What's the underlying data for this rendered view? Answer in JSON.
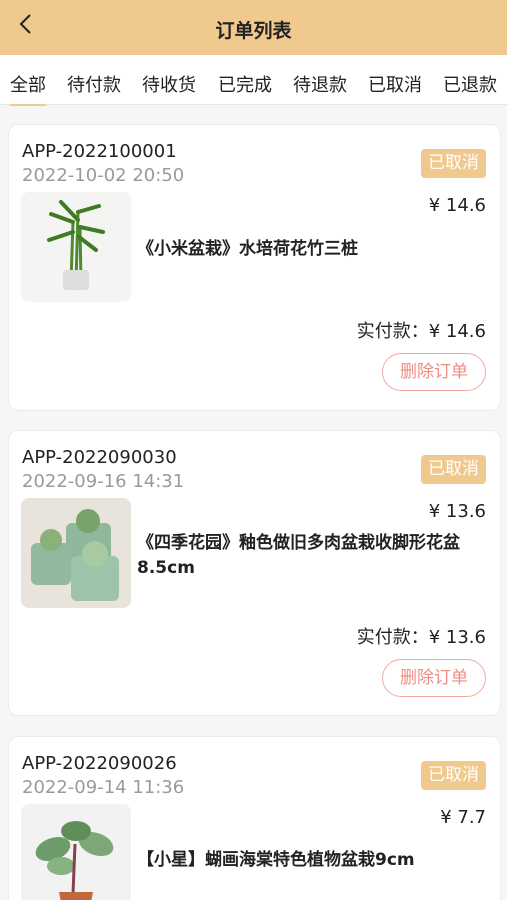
{
  "header": {
    "title": "订单列表"
  },
  "tabs": [
    "全部",
    "待付款",
    "待收货",
    "已完成",
    "待退款",
    "已取消",
    "已退款"
  ],
  "orders": [
    {
      "order_no": "APP-2022100001",
      "time": "2022-10-02 20:50",
      "status": "已取消",
      "price": "¥ 14.6",
      "product_name": "《小米盆栽》水培荷花竹三桩",
      "paid_label": "实付款：¥ 14.6",
      "action_label": "删除订单"
    },
    {
      "order_no": "APP-2022090030",
      "time": "2022-09-16 14:31",
      "status": "已取消",
      "price": "¥ 13.6",
      "product_name": "《四季花园》釉色做旧多肉盆栽收脚形花盆8.5cm",
      "paid_label": "实付款：¥ 13.6",
      "action_label": "删除订单"
    },
    {
      "order_no": "APP-2022090026",
      "time": "2022-09-14 11:36",
      "status": "已取消",
      "price": "¥ 7.7",
      "product_name": "【小星】蝴画海棠特色植物盆栽9cm"
    }
  ],
  "colors": {
    "header_bg": "#efc98d",
    "badge_bg": "#f0c98f",
    "delete_border": "#f2a9a3",
    "delete_text": "#ef8c84"
  }
}
